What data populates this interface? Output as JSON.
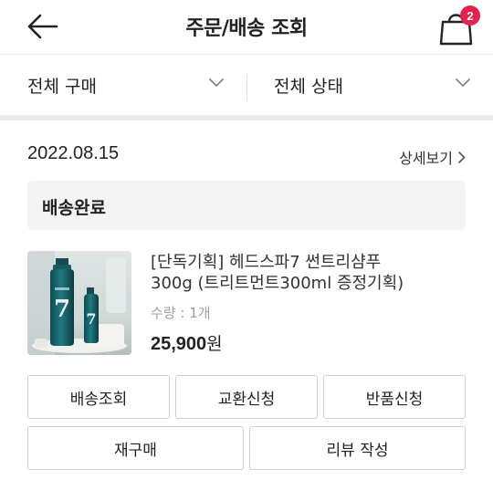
{
  "header": {
    "title": "주문/배송 조회",
    "back_icon": "arrow-left-icon",
    "cart_icon": "shopping-bag-icon",
    "cart_count": "2",
    "badge_color": "#e8204d"
  },
  "filters": {
    "purchase": "전체 구매",
    "status": "전체 상태",
    "dropdown_icon": "chevron-down-icon"
  },
  "order": {
    "date": "2022.08.15",
    "detail_link": "상세보기",
    "detail_icon": "chevron-right-icon",
    "status": "배송완료",
    "product": {
      "name_line1": "[단독기획] 헤드스파7 썬트리샴푸",
      "name_line2": "300g (트리트먼트300ml 증정기획)",
      "quantity": "수량 : 1개",
      "price": "25,900",
      "currency": "원"
    }
  },
  "actions": {
    "track": "배송조회",
    "exchange": "교환신청",
    "return": "반품신청",
    "rebuy": "재구매",
    "review": "리뷰 작성"
  }
}
